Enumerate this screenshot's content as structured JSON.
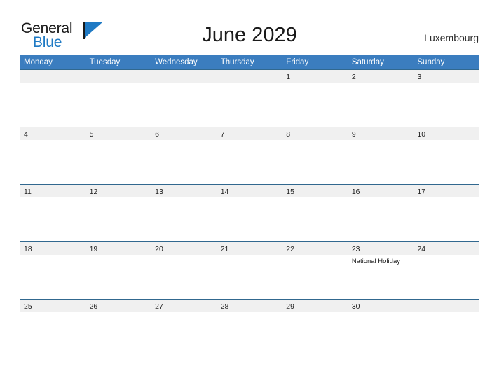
{
  "logo": {
    "word_one": "General",
    "word_two": "Blue",
    "mark": "triangle-flag-icon",
    "colors": {
      "blue": "#1f7ac4",
      "dark": "#1a1a1a"
    }
  },
  "header": {
    "title": "June 2029",
    "region": "Luxembourg"
  },
  "calendar": {
    "colors": {
      "header_blue": "#3b7dbf",
      "row_line": "#31688f",
      "day_band": "#f0f0f0"
    },
    "weekday_headers": [
      "Monday",
      "Tuesday",
      "Wednesday",
      "Thursday",
      "Friday",
      "Saturday",
      "Sunday"
    ],
    "weeks": [
      [
        {
          "day": "",
          "event": ""
        },
        {
          "day": "",
          "event": ""
        },
        {
          "day": "",
          "event": ""
        },
        {
          "day": "",
          "event": ""
        },
        {
          "day": "1",
          "event": ""
        },
        {
          "day": "2",
          "event": ""
        },
        {
          "day": "3",
          "event": ""
        }
      ],
      [
        {
          "day": "4",
          "event": ""
        },
        {
          "day": "5",
          "event": ""
        },
        {
          "day": "6",
          "event": ""
        },
        {
          "day": "7",
          "event": ""
        },
        {
          "day": "8",
          "event": ""
        },
        {
          "day": "9",
          "event": ""
        },
        {
          "day": "10",
          "event": ""
        }
      ],
      [
        {
          "day": "11",
          "event": ""
        },
        {
          "day": "12",
          "event": ""
        },
        {
          "day": "13",
          "event": ""
        },
        {
          "day": "14",
          "event": ""
        },
        {
          "day": "15",
          "event": ""
        },
        {
          "day": "16",
          "event": ""
        },
        {
          "day": "17",
          "event": ""
        }
      ],
      [
        {
          "day": "18",
          "event": ""
        },
        {
          "day": "19",
          "event": ""
        },
        {
          "day": "20",
          "event": ""
        },
        {
          "day": "21",
          "event": ""
        },
        {
          "day": "22",
          "event": ""
        },
        {
          "day": "23",
          "event": "National Holiday"
        },
        {
          "day": "24",
          "event": ""
        }
      ],
      [
        {
          "day": "25",
          "event": ""
        },
        {
          "day": "26",
          "event": ""
        },
        {
          "day": "27",
          "event": ""
        },
        {
          "day": "28",
          "event": ""
        },
        {
          "day": "29",
          "event": ""
        },
        {
          "day": "30",
          "event": ""
        },
        {
          "day": "",
          "event": ""
        }
      ]
    ]
  }
}
